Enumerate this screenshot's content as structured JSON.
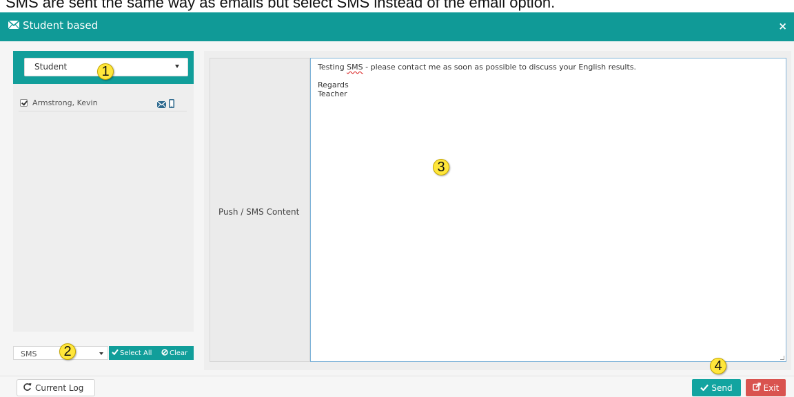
{
  "caption": "SMS are sent the same way as emails but select SMS instead of the email option.",
  "dialog": {
    "title": "Student based",
    "close_label": "×"
  },
  "left_panel": {
    "filter_select_value": "Student",
    "students": [
      {
        "name": "Armstrong, Kevin",
        "checked": true
      }
    ],
    "channel_select_value": "SMS",
    "select_all_label": "Select All",
    "clear_label": "Clear"
  },
  "content": {
    "label": "Push / SMS Content",
    "message_line1_pre": "Testing ",
    "message_line1_misspelled": "SMS",
    "message_line1_post": " - please contact me as soon as possible to discuss your English results.",
    "message_line2": "Regards",
    "message_line3": "Teacher"
  },
  "footer": {
    "log_label": "Current Log",
    "send_label": "Send",
    "exit_label": "Exit"
  },
  "annotations": [
    "1",
    "2",
    "3",
    "4"
  ],
  "colors": {
    "header": "#109a97",
    "accent": "#119e9a",
    "danger": "#d9534f",
    "badge": "#ffe63b"
  },
  "icons": [
    "envelope-icon",
    "close-icon",
    "mobile-icon",
    "check-icon",
    "ban-icon",
    "refresh-icon",
    "exit-icon"
  ]
}
